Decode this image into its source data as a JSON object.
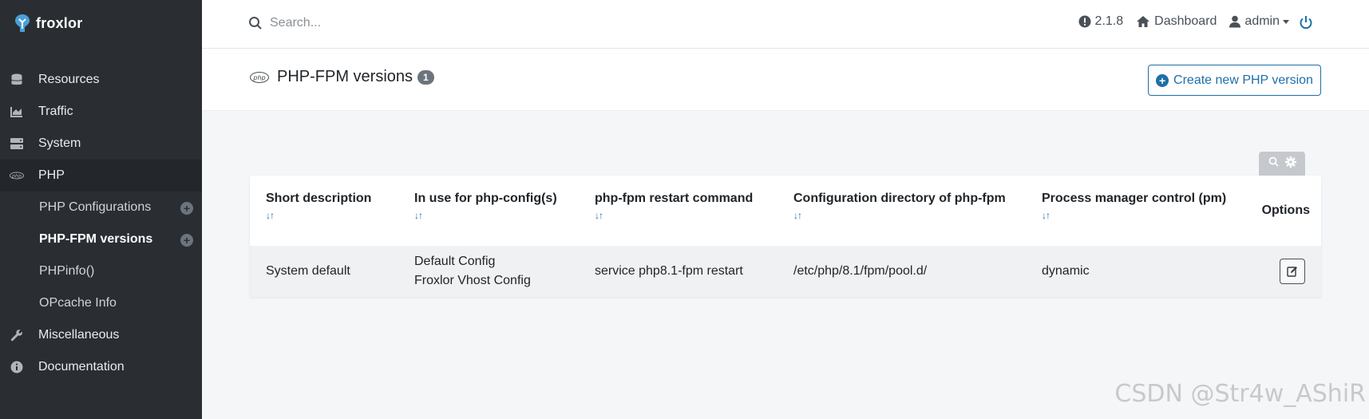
{
  "brand": {
    "name": "froxlor"
  },
  "sidebar": {
    "items": [
      {
        "label": "Resources",
        "icon": "database-icon"
      },
      {
        "label": "Traffic",
        "icon": "chart-icon"
      },
      {
        "label": "System",
        "icon": "server-icon"
      },
      {
        "label": "PHP",
        "icon": "php-icon",
        "active": true
      },
      {
        "label": "Miscellaneous",
        "icon": "wrench-icon"
      },
      {
        "label": "Documentation",
        "icon": "info-icon"
      }
    ],
    "php_sub": [
      {
        "label": "PHP Configurations",
        "has_add": true
      },
      {
        "label": "PHP-FPM versions",
        "has_add": true,
        "active": true
      },
      {
        "label": "PHPinfo()"
      },
      {
        "label": "OPcache Info"
      }
    ]
  },
  "topbar": {
    "search_placeholder": "Search...",
    "version": "2.1.8",
    "dashboard": "Dashboard",
    "user": "admin"
  },
  "page": {
    "title": "PHP-FPM versions",
    "count": "1",
    "create_button": "Create new PHP version"
  },
  "table": {
    "columns": [
      "Short description",
      "In use for php-config(s)",
      "php-fpm restart command",
      "Configuration directory of php-fpm",
      "Process manager control (pm)",
      "Options"
    ],
    "sort_glyph": "↓↑",
    "rows": [
      {
        "description": "System default",
        "configs": [
          "Default Config",
          "Froxlor Vhost Config"
        ],
        "restart": "service php8.1-fpm restart",
        "config_dir": "/etc/php/8.1/fpm/pool.d/",
        "pm": "dynamic"
      }
    ]
  },
  "watermark": "CSDN @Str4w_AShiR",
  "colors": {
    "accent": "#1e6fa8",
    "sidebar_bg": "#2a2e33"
  }
}
